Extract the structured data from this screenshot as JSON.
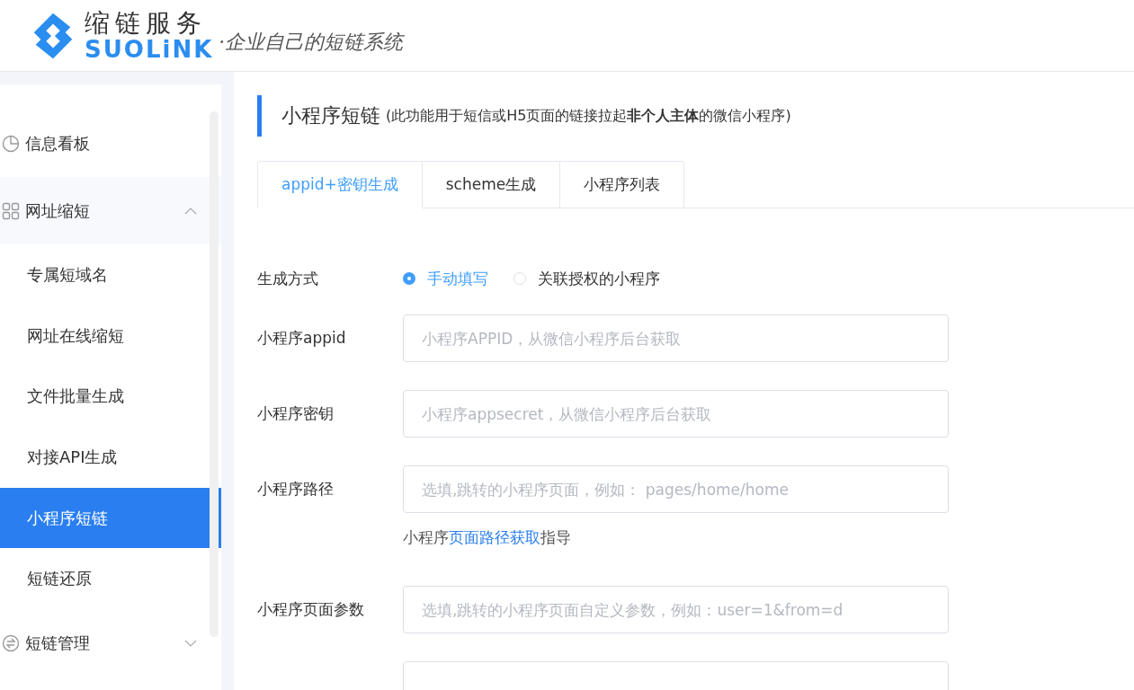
{
  "header": {
    "logo_title": "缩链服务",
    "logo_brand": "SUOLiNK",
    "slogan": "·企业自己的短链系统"
  },
  "sidebar": {
    "items": [
      {
        "label": "信息看板",
        "kind": "leaf"
      },
      {
        "label": "网址缩短",
        "kind": "menu",
        "expanded": true,
        "children": [
          {
            "label": "专属短域名",
            "selected": false
          },
          {
            "label": "网址在线缩短",
            "selected": false
          },
          {
            "label": "文件批量生成",
            "selected": false
          },
          {
            "label": "对接API生成",
            "selected": false
          },
          {
            "label": "小程序短链",
            "selected": true
          },
          {
            "label": "短链还原",
            "selected": false
          }
        ]
      },
      {
        "label": "短链管理",
        "kind": "menu",
        "expanded": false
      }
    ]
  },
  "page": {
    "title": "小程序短链",
    "subtitle": "(此功能用于短信或H5页面的链接拉起**非个人主体**的微信小程序)",
    "tabs": [
      {
        "label": "appid+密钥生成",
        "selected": true
      },
      {
        "label": "scheme生成",
        "selected": false
      },
      {
        "label": "小程序列表",
        "selected": false
      }
    ],
    "method": {
      "label": "生成方式",
      "options": [
        {
          "label": "手动填写",
          "selected": true
        },
        {
          "label": "关联授权的小程序",
          "selected": false
        }
      ]
    },
    "fields": [
      {
        "label": "小程序appid",
        "placeholder": "小程序APPID，从微信小程序后台获取"
      },
      {
        "label": "小程序密钥",
        "placeholder": "小程序appsecret，从微信小程序后台获取"
      },
      {
        "label": "小程序路径",
        "placeholder": "选填,跳转的小程序页面，例如： pages/home/home",
        "hint": {
          "before": "小程序",
          "link": "页面路径获取",
          "after": "指导"
        }
      },
      {
        "label": "小程序页面参数",
        "placeholder": "选填,跳转的小程序页面自定义参数，例如：user=1&from=d"
      }
    ]
  }
}
